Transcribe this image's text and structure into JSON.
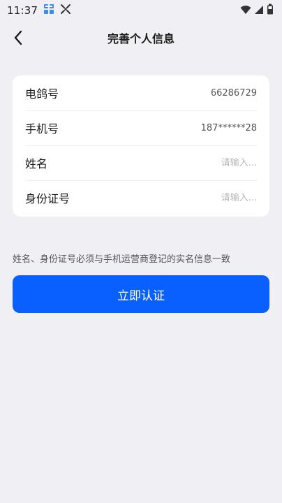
{
  "status_bar": {
    "time": "11:37",
    "icons": [
      "notification-app-icon",
      "scan-app-icon",
      "wifi-icon",
      "cellular-signal-icon",
      "battery-icon"
    ]
  },
  "header": {
    "title": "完善个人信息",
    "back_icon": "chevron-left-icon"
  },
  "form": {
    "rows": [
      {
        "label": "电鸽号",
        "value": "66286729"
      },
      {
        "label": "手机号",
        "value": "187******28"
      },
      {
        "label": "姓名",
        "placeholder": "请输入..."
      },
      {
        "label": "身份证号",
        "placeholder": "请输入..."
      }
    ]
  },
  "hint": "姓名、身份证号必须与手机运营商登记的实名信息一致",
  "submit_button": {
    "label": "立即认证"
  },
  "colors": {
    "background": "#f0eff4",
    "card": "#ffffff",
    "accent": "#0a60ff",
    "placeholder": "#b7b7bb"
  }
}
